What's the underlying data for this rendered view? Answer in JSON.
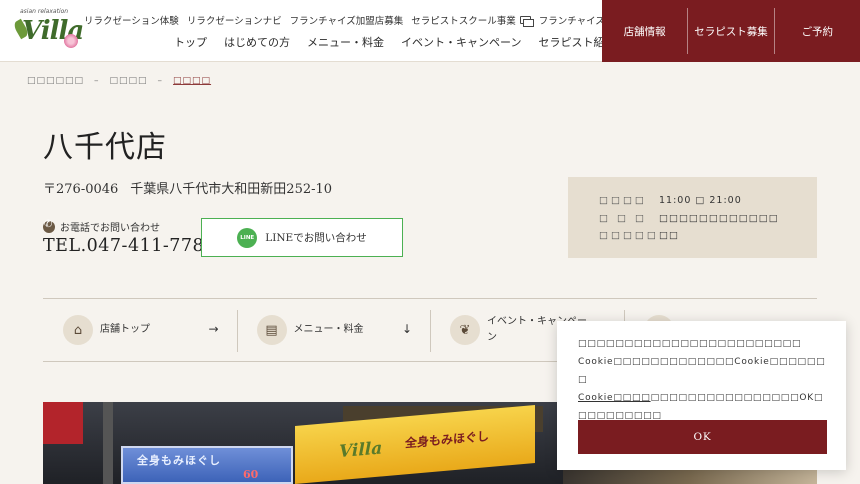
{
  "header": {
    "logo": {
      "tagline": "asian relaxation",
      "wordmark": "Villa"
    },
    "subnav": [
      {
        "label": "リラクゼーション体験",
        "external": false
      },
      {
        "label": "リラクゼーションナビ",
        "external": false
      },
      {
        "label": "フランチャイズ加盟店募集",
        "external": false
      },
      {
        "label": "セラピストスクール事業",
        "external": true
      },
      {
        "label": "フランチャイズ本部支援",
        "external": true
      }
    ],
    "mainnav": [
      "トップ",
      "はじめての方",
      "メニュー・料金",
      "イベント・キャンペーン",
      "セラピスト紹介"
    ],
    "cta": [
      "店舗情報",
      "セラピスト募集",
      "ご予約"
    ]
  },
  "breadcrumb": [
    "□□□□□□",
    "□□□□",
    "□□□□"
  ],
  "store": {
    "title": "八千代店",
    "zip": "〒276-0046",
    "address": "千葉県八千代市大和田新田252-10",
    "tel_label": "お電話でお問い合わせ",
    "tel": "TEL.047-411-7787",
    "line_label": "LINEでお問い合わせ",
    "line_icon_text": "LINE"
  },
  "hours": [
    {
      "label": "□□□□",
      "value": "11:00 □ 21:00"
    },
    {
      "label": "□ □ □",
      "value": "□□□□□□□□□□□□"
    },
    {
      "label": "□□□□□",
      "value": "□□"
    }
  ],
  "sections": [
    {
      "label": "店舗トップ",
      "icon": "shop-icon",
      "icon_glyph": "⌂",
      "arrow": "→"
    },
    {
      "label": "メニュー・料金",
      "icon": "document-icon",
      "icon_glyph": "▤",
      "arrow": "↓"
    },
    {
      "label": "イベント・キャンペーン",
      "icon": "leaf-icon",
      "icon_glyph": "❦",
      "arrow": ""
    },
    {
      "label": "",
      "icon": "circle-icon",
      "icon_glyph": "",
      "arrow": ""
    }
  ],
  "photo": {
    "sign_left_text": "全身もみほぐし",
    "sign_left_number": "60",
    "sign_main_brand": "Villa",
    "sign_main_text": "全身もみほぐし"
  },
  "cookie": {
    "line1": "□□□□□□□□□□□□□□□□□□□□□□□□",
    "line2": "Cookie□□□□□□□□□□□□□Cookie□□□□□□□",
    "link": "Cookie□□□□",
    "line3_rest": "□□□□□□□□□□□□□□□□OK□□□□□□□□□□",
    "line4": "□□□□",
    "ok_label": "OK"
  },
  "colors": {
    "accent": "#7a1c20",
    "line_green": "#4cb052",
    "panel": "#e6ded0"
  }
}
